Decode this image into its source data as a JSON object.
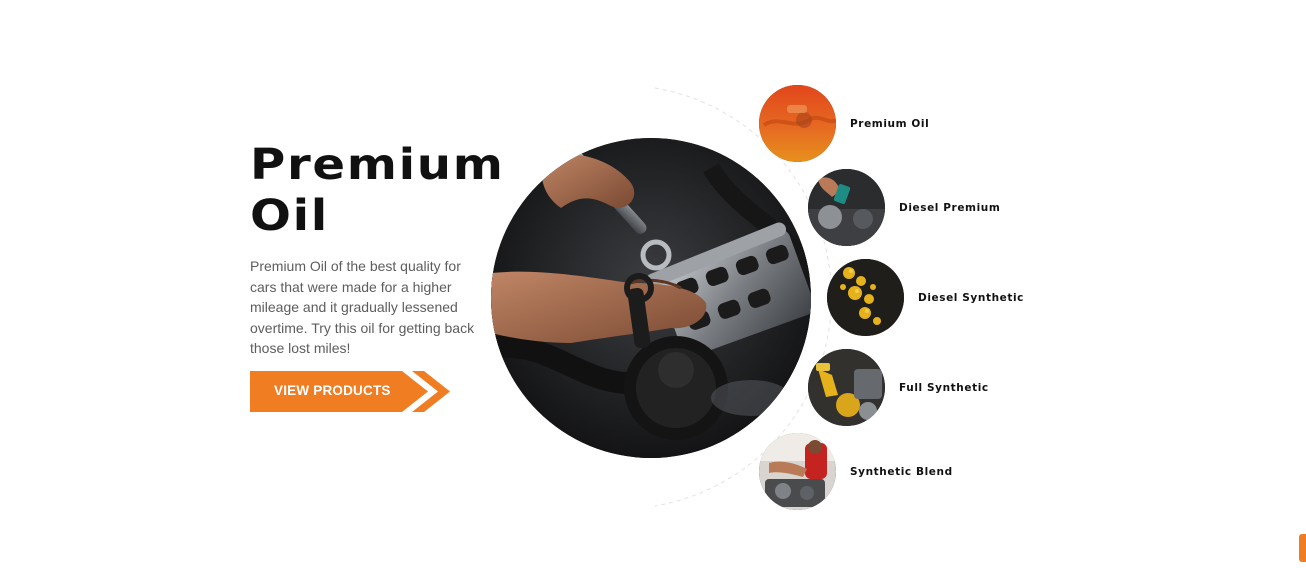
{
  "hero": {
    "title_line1": "Premium",
    "title_line2": "Oil",
    "description": "Premium Oil of the best quality for cars that were made for a higher mileage and it gradually lessened overtime. Try this oil for getting back those lost miles!",
    "cta_label": "VIEW PRODUCTS"
  },
  "products": [
    {
      "label": "Premium Oil",
      "icon": "premium-oil-image"
    },
    {
      "label": "Diesel Premium",
      "icon": "diesel-premium-image"
    },
    {
      "label": "Diesel Synthetic",
      "icon": "diesel-synthetic-image"
    },
    {
      "label": "Full Synthetic",
      "icon": "full-synthetic-image"
    },
    {
      "label": "Synthetic Blend",
      "icon": "synthetic-blend-image"
    }
  ],
  "colors": {
    "accent": "#f07d22",
    "title": "#111111",
    "body_text": "#5d5d5d",
    "background": "#ffffff"
  }
}
